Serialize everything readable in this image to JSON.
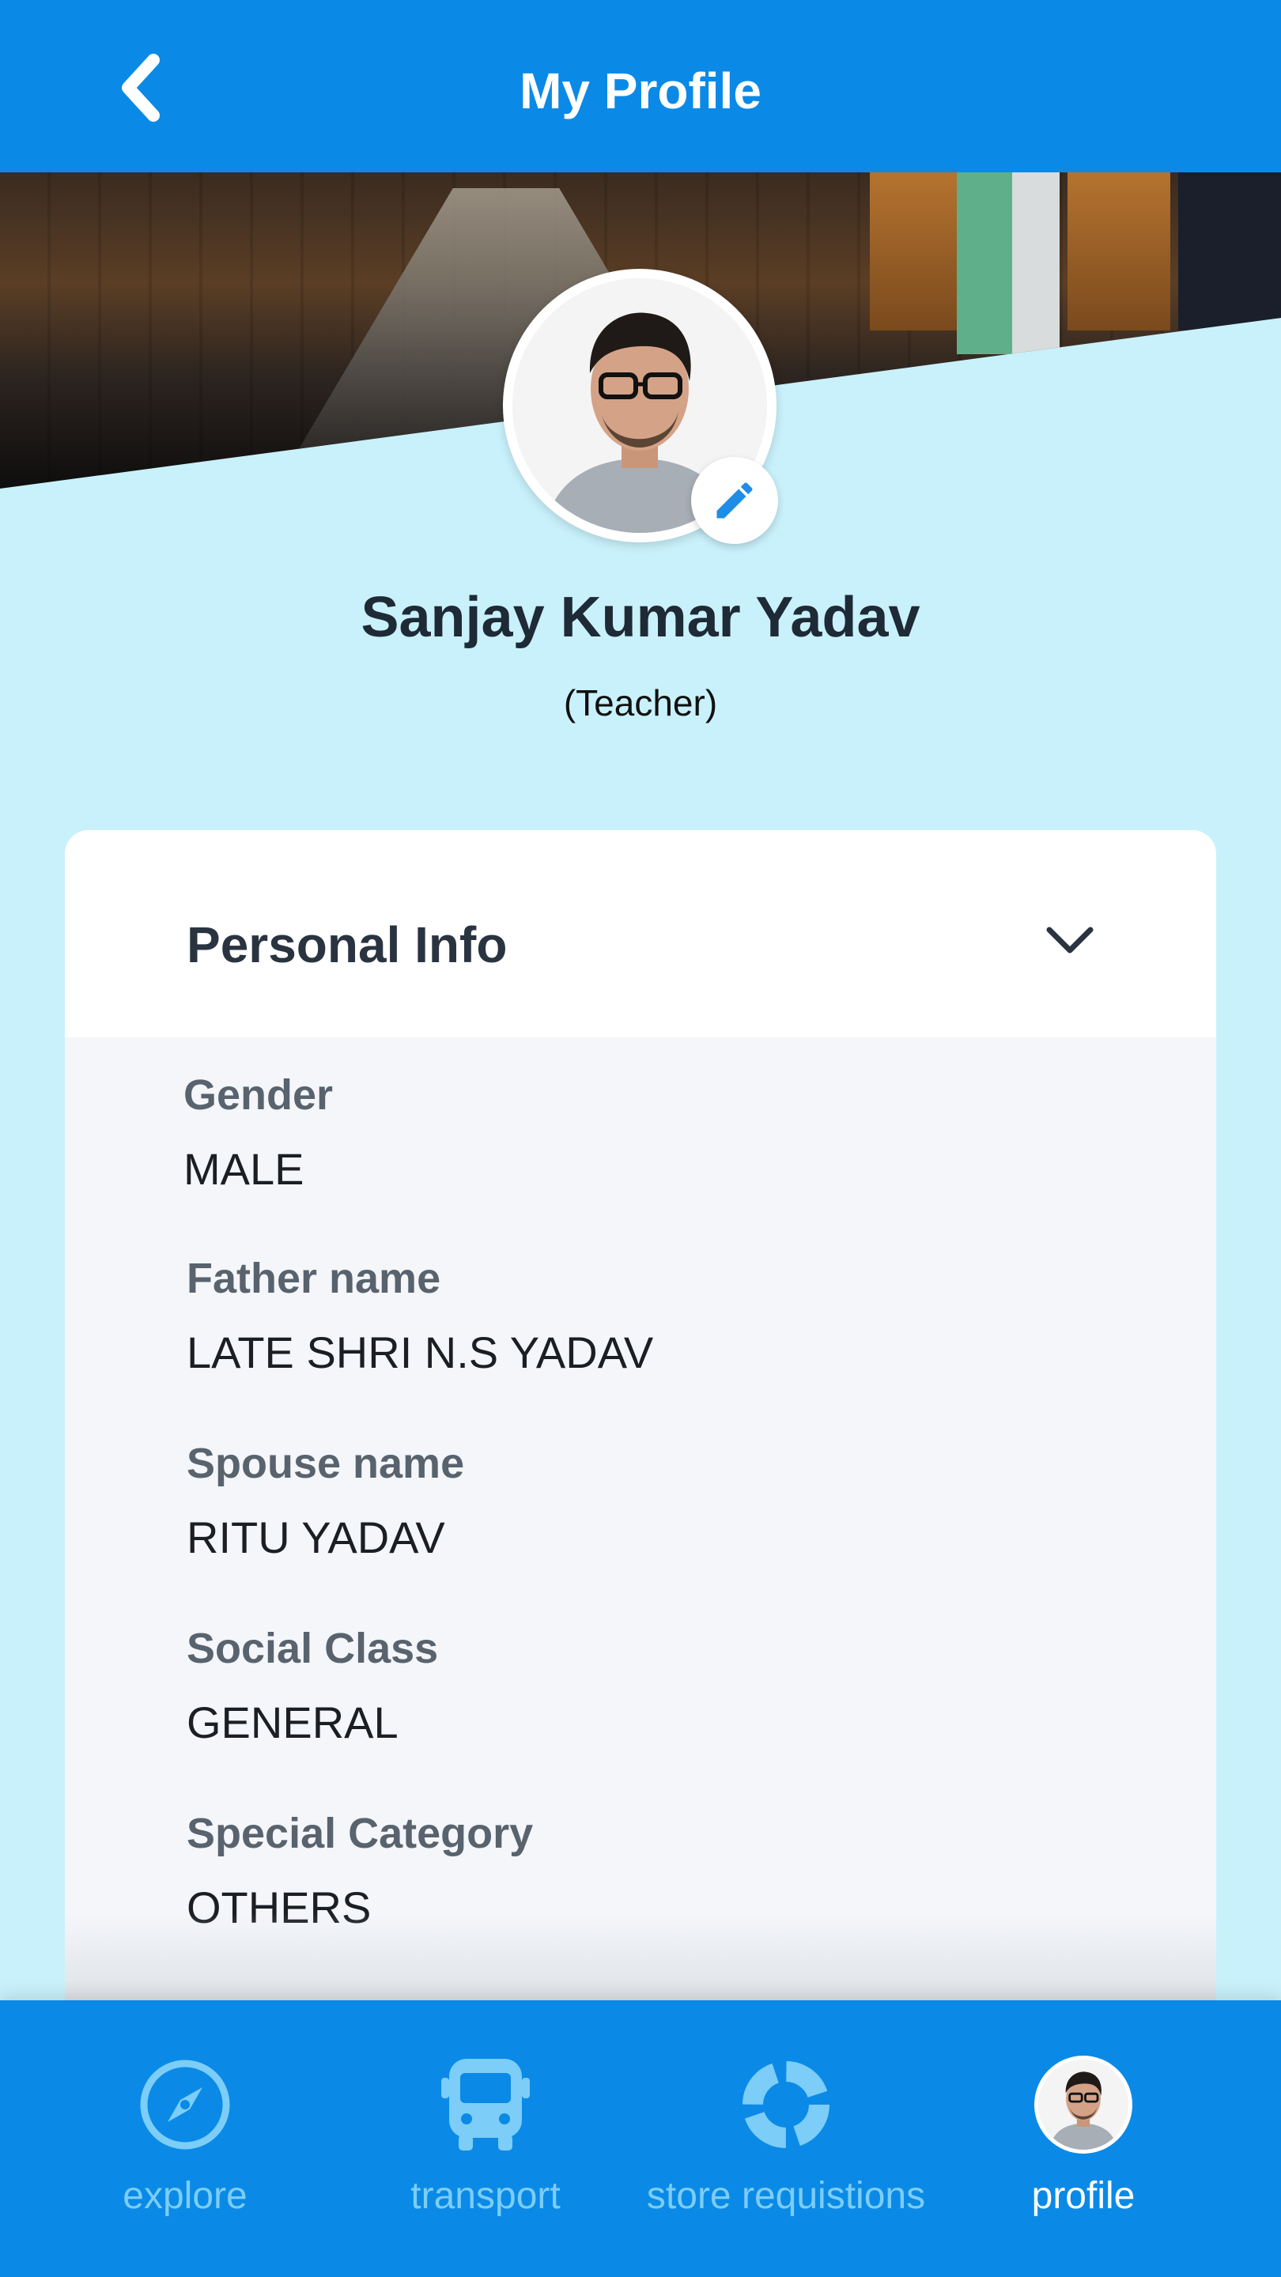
{
  "header": {
    "title": "My Profile",
    "back_icon": "chevron-left-icon"
  },
  "profile": {
    "name": "Sanjay Kumar Yadav",
    "role": "(Teacher)",
    "edit_icon": "pencil-icon"
  },
  "personal_info": {
    "section_title": "Personal Info",
    "toggle_icon": "chevron-down-icon",
    "fields": [
      {
        "label": "Gender",
        "value": "MALE"
      },
      {
        "label": "Father name",
        "value": "LATE SHRI N.S YADAV"
      },
      {
        "label": "Spouse name",
        "value": "RITU YADAV"
      },
      {
        "label": "Social Class",
        "value": "GENERAL"
      },
      {
        "label": "Special Category",
        "value": "OTHERS"
      }
    ]
  },
  "bottom_nav": {
    "items": [
      {
        "label": "explore",
        "icon": "compass-icon",
        "active": false
      },
      {
        "label": "transport",
        "icon": "bus-icon",
        "active": false
      },
      {
        "label": "store requistions",
        "icon": "refresh-icon",
        "active": false
      },
      {
        "label": "profile",
        "icon": "avatar",
        "active": true
      }
    ]
  },
  "colors": {
    "primary": "#0a8ae6",
    "background": "#c9f1fb",
    "card": "#f4f6fa",
    "nav_inactive": "#7ccdf7",
    "nav_active": "#ffffff"
  }
}
